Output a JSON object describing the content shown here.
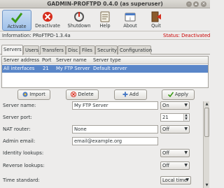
{
  "window": {
    "title": "GADMIN-PROFTPD 0.4.0 (as superuser)"
  },
  "toolbar": {
    "activate": "Activate",
    "deactivate": "Deactivate",
    "shutdown": "Shutdown",
    "help": "Help",
    "about": "About",
    "quit": "Quit"
  },
  "info": {
    "label": "Information: PRoFTPD-1.3.4a",
    "status": "Status: Deactivated"
  },
  "tabs": [
    "Servers",
    "Users",
    "Transfers",
    "Disc",
    "Files",
    "Security",
    "Configuration"
  ],
  "table": {
    "headers": [
      "Server address",
      "Port",
      "Server name",
      "Server type"
    ],
    "rows": [
      [
        "All interfaces",
        "21",
        "My FTP Server",
        "Default server"
      ]
    ]
  },
  "buttons": {
    "import": "Import",
    "delete": "Delete",
    "add": "Add",
    "apply": "Apply"
  },
  "form": {
    "server_name": {
      "label": "Server name:",
      "value": "My FTP Server",
      "option": "On"
    },
    "server_port": {
      "label": "Server port:",
      "value": "21"
    },
    "nat_router": {
      "label": "NAT router:",
      "value": "None",
      "option": "Off"
    },
    "admin_email": {
      "label": "Admin email:",
      "value": "email@example.org"
    },
    "identity_lookups": {
      "label": "Identity lookups:",
      "option": "Off"
    },
    "reverse_lookups": {
      "label": "Reverse lookups:",
      "option": "Off"
    },
    "time_standard": {
      "label": "Time standard:",
      "option": "Local time"
    }
  },
  "colors": {
    "selection": "#5a86c8",
    "status": "#cc0000",
    "active_tool": "#9fc1ea"
  }
}
